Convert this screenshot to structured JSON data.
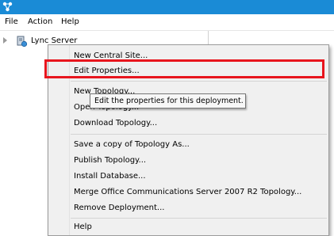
{
  "menubar": {
    "items": [
      "File",
      "Action",
      "Help"
    ]
  },
  "tree": {
    "root_label": "Lync Server"
  },
  "context_menu": {
    "items": [
      "New Central Site...",
      "Edit Properties...",
      "New Topology...",
      "Open Topology...",
      "Download Topology...",
      "Save a copy of Topology As...",
      "Publish Topology...",
      "Install Database...",
      "Merge Office Communications Server 2007 R2 Topology...",
      "Remove Deployment...",
      "Help"
    ]
  },
  "tooltip": {
    "text": "Edit the properties for this deployment."
  },
  "colors": {
    "titlebar": "#1a8bd6",
    "highlight": "#e8151d"
  },
  "icons": {
    "app": "topology-builder-icon",
    "tree_root": "lync-server-icon",
    "expander": "tree-expand-arrow-icon"
  }
}
